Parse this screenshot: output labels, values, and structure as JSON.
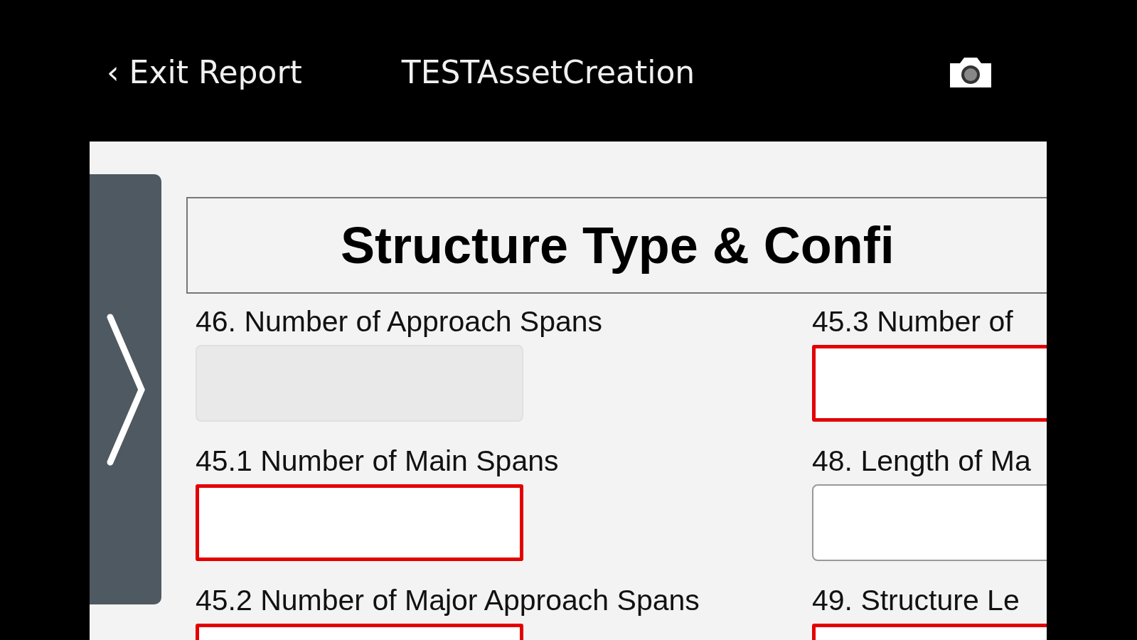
{
  "header": {
    "back": "‹ Exit Report",
    "title": "TESTAssetCreation"
  },
  "section": {
    "heading": "Structure Type & Confi"
  },
  "fields": [
    {
      "label": "46. Number of Approach Spans",
      "required": false,
      "disabled": true
    },
    {
      "label": "45.3 Number of",
      "required": true,
      "disabled": false
    },
    {
      "label": "45.1 Number of Main Spans",
      "required": true,
      "disabled": false
    },
    {
      "label": "48. Length of Ma",
      "required": false,
      "disabled": false
    },
    {
      "label": "45.2 Number of Major Approach Spans",
      "required": true,
      "disabled": false
    },
    {
      "label": "49. Structure Le",
      "required": true,
      "disabled": false
    }
  ]
}
